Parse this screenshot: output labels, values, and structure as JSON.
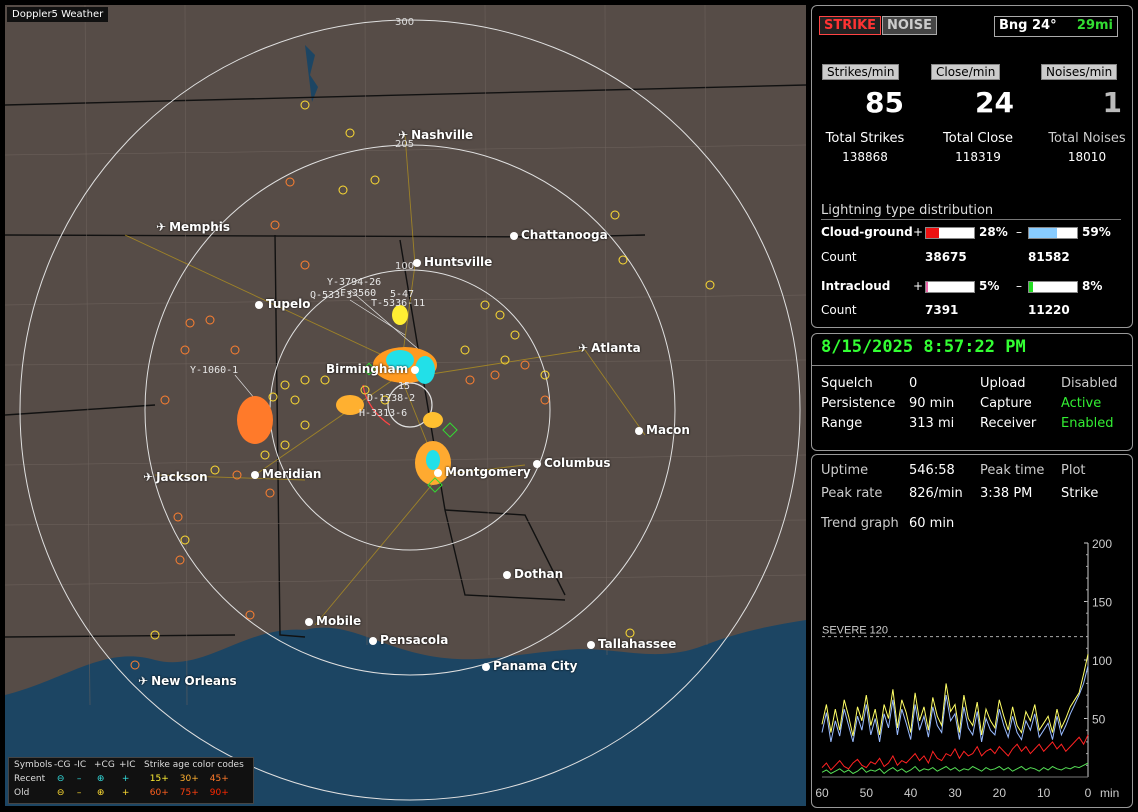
{
  "app": {
    "title": "Doppler5 Weather"
  },
  "map": {
    "ring_labels": [
      "300",
      "205",
      "100"
    ],
    "cities": [
      {
        "name": "Nashville",
        "airport": true
      },
      {
        "name": "Memphis",
        "airport": true
      },
      {
        "name": "Chattanooga",
        "airport": false
      },
      {
        "name": "Huntsville",
        "airport": false
      },
      {
        "name": "Tupelo",
        "airport": false
      },
      {
        "name": "Atlanta",
        "airport": true
      },
      {
        "name": "Birmingham",
        "airport": false
      },
      {
        "name": "Macon",
        "airport": false
      },
      {
        "name": "Jackson",
        "airport": true
      },
      {
        "name": "Meridian",
        "airport": false
      },
      {
        "name": "Montgomery",
        "airport": false
      },
      {
        "name": "Columbus",
        "airport": false
      },
      {
        "name": "Dothan",
        "airport": false
      },
      {
        "name": "Mobile",
        "airport": false
      },
      {
        "name": "Pensacola",
        "airport": false
      },
      {
        "name": "Tallahassee",
        "airport": false
      },
      {
        "name": "Panama City",
        "airport": false
      },
      {
        "name": "New Orleans",
        "airport": true
      }
    ],
    "strike_labels": [
      "Y-3794-26",
      "Q-533-3",
      "F-3560",
      "5-47",
      "T-5336-11",
      "Y-1060-1",
      "15",
      "D-1238-2",
      "H-3313-6"
    ],
    "legend": {
      "symbols_label": "Symbols",
      "headers": [
        "-CG",
        "-IC",
        "+CG",
        "+IC"
      ],
      "age_title": "Strike age color codes",
      "recent_label": "Recent",
      "old_label": "Old",
      "recent_ages": [
        "15+",
        "30+",
        "45+"
      ],
      "old_ages": [
        "60+",
        "75+",
        "90+"
      ],
      "age_colors": [
        "#ffee33",
        "#ffb030",
        "#ff7a2a",
        "#ff6020",
        "#ff4010",
        "#ff2800"
      ]
    }
  },
  "mode": {
    "strike": "STRIKE",
    "noise": "NOISE",
    "bearing": "Bng 24°",
    "distance": "29mi"
  },
  "rates": {
    "strikes_label": "Strikes/min",
    "strikes": "85",
    "close_label": "Close/min",
    "close": "24",
    "noises_label": "Noises/min",
    "noises": "1"
  },
  "totals": {
    "strikes_label": "Total Strikes",
    "strikes": "138868",
    "close_label": "Total Close",
    "close": "118319",
    "noises_label": "Total Noises",
    "noises": "18010"
  },
  "distribution": {
    "title": "Lightning type distribution",
    "count_label": "Count",
    "cloud_ground": {
      "label": "Cloud-ground",
      "pos_sign": "+",
      "neg_sign": "–",
      "pos_pct": "28%",
      "neg_pct": "59%",
      "pos_frac": 0.28,
      "neg_frac": 0.59,
      "pos_count": "38675",
      "neg_count": "81582",
      "pos_color": "#ee1111",
      "neg_color": "#88ccff"
    },
    "intracloud": {
      "label": "Intracloud",
      "pos_sign": "+",
      "neg_sign": "–",
      "pos_pct": "5%",
      "neg_pct": "8%",
      "pos_frac": 0.05,
      "neg_frac": 0.08,
      "pos_count": "7391",
      "neg_count": "11220",
      "pos_color": "#ee66aa",
      "neg_color": "#22dd22"
    }
  },
  "status": {
    "datetime": "8/15/2025 8:57:22 PM",
    "squelch_label": "Squelch",
    "squelch": "0",
    "persistence_label": "Persistence",
    "persistence": "90 min",
    "range_label": "Range",
    "range": "313 mi",
    "upload_label": "Upload",
    "upload": "Disabled",
    "capture_label": "Capture",
    "capture": "Active",
    "receiver_label": "Receiver",
    "receiver": "Enabled"
  },
  "stats": {
    "uptime_label": "Uptime",
    "uptime": "546:58",
    "peak_time_label": "Peak time",
    "peak_time": "3:38 PM",
    "plot_label": "Plot",
    "plot": "Strike",
    "peak_rate_label": "Peak rate",
    "peak_rate": "826/min",
    "trend_label": "Trend graph",
    "trend": "60 min"
  },
  "chart_data": {
    "type": "line",
    "x_label": "min",
    "x_ticks": [
      "60",
      "50",
      "40",
      "30",
      "20",
      "10",
      "0"
    ],
    "y_ticks": [
      "200",
      "150",
      "100",
      "50"
    ],
    "ylim": [
      0,
      200
    ],
    "xlim": [
      60,
      0
    ],
    "threshold": {
      "label": "SEVERE 120",
      "value": 120
    },
    "series": [
      {
        "color": "#ffff66",
        "values": [
          45,
          62,
          38,
          58,
          40,
          66,
          52,
          35,
          60,
          48,
          70,
          44,
          58,
          36,
          62,
          50,
          75,
          42,
          66,
          55,
          38,
          72,
          48,
          60,
          40,
          68,
          52,
          44,
          80,
          56,
          62,
          38,
          70,
          50,
          44,
          64,
          36,
          58,
          48,
          42,
          66,
          52,
          40,
          60,
          44,
          38,
          56,
          48,
          62,
          40,
          46,
          52,
          38,
          58,
          42,
          50,
          60,
          66,
          72,
          88,
          105
        ]
      },
      {
        "color": "#99bbff",
        "values": [
          38,
          55,
          30,
          48,
          35,
          58,
          44,
          30,
          52,
          40,
          62,
          36,
          50,
          30,
          54,
          42,
          66,
          36,
          58,
          46,
          32,
          62,
          40,
          52,
          34,
          60,
          44,
          38,
          70,
          48,
          54,
          32,
          60,
          42,
          36,
          56,
          30,
          50,
          40,
          36,
          58,
          44,
          34,
          52,
          38,
          32,
          48,
          40,
          54,
          34,
          40,
          46,
          32,
          52,
          36,
          44,
          54,
          62,
          70,
          80,
          95
        ]
      },
      {
        "color": "#ff2222",
        "values": [
          8,
          12,
          6,
          10,
          14,
          9,
          7,
          12,
          15,
          10,
          8,
          13,
          11,
          16,
          9,
          12,
          18,
          10,
          14,
          12,
          16,
          20,
          14,
          18,
          12,
          22,
          16,
          14,
          20,
          18,
          24,
          16,
          22,
          18,
          20,
          26,
          18,
          22,
          24,
          20,
          26,
          22,
          18,
          24,
          28,
          22,
          26,
          20,
          24,
          28,
          22,
          26,
          30,
          24,
          28,
          22,
          26,
          30,
          34,
          28,
          36
        ]
      },
      {
        "color": "#55dd55",
        "values": [
          4,
          6,
          3,
          5,
          7,
          4,
          6,
          3,
          5,
          8,
          4,
          6,
          5,
          7,
          3,
          6,
          8,
          5,
          7,
          4,
          6,
          9,
          5,
          7,
          6,
          8,
          5,
          7,
          9,
          6,
          8,
          5,
          7,
          6,
          9,
          7,
          5,
          8,
          6,
          7,
          9,
          6,
          8,
          5,
          7,
          9,
          6,
          8,
          7,
          5,
          8,
          6,
          9,
          7,
          6,
          8,
          7,
          9,
          8,
          10,
          12
        ]
      }
    ]
  }
}
